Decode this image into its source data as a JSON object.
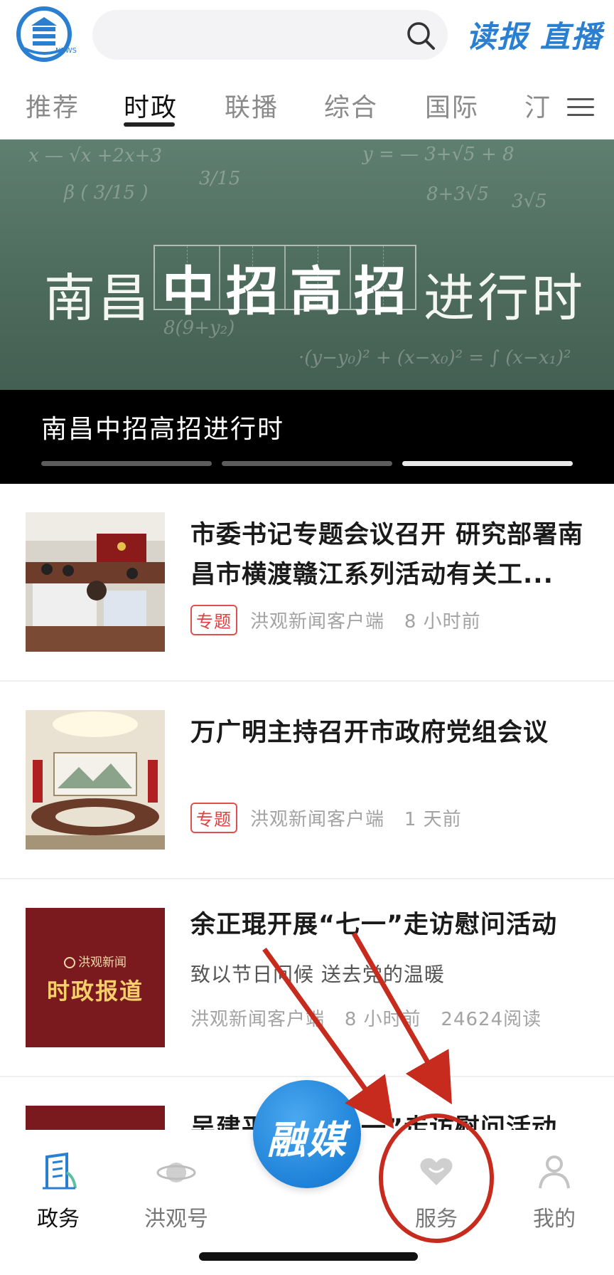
{
  "header": {
    "logo_text": "NEWS",
    "search_placeholder": "",
    "dubao_label": "读报",
    "zhibo_label": "直播"
  },
  "tabs": [
    {
      "label": "推荐"
    },
    {
      "label": "时政"
    },
    {
      "label": "联播"
    },
    {
      "label": "综合"
    },
    {
      "label": "国际"
    },
    {
      "label": "汀"
    }
  ],
  "active_tab": "时政",
  "banner": {
    "headline_left": "南昌",
    "headline_big": "中招高招",
    "headline_right": "进行时",
    "caption": "南昌中招高招进行时",
    "slide_count": 3,
    "active_slide": 3
  },
  "news": [
    {
      "title": "市委书记专题会议召开 研究部署南昌市横渡赣江系列活动有关工...",
      "tag": "专题",
      "source": "洪观新闻客户端",
      "time": "8 小时前"
    },
    {
      "title": "万广明主持召开市政府党组会议",
      "tag": "专题",
      "source": "洪观新闻客户端",
      "time": "1 天前"
    },
    {
      "title": "余正琨开展“七一”走访慰问活动",
      "subtitle": "致以节日问候 送去党的温暖",
      "thumb_brand": "洪观新闻",
      "thumb_title": "时政报道",
      "source": "洪观新闻客户端",
      "time": "8 小时前",
      "reads": "24624阅读"
    },
    {
      "title": "吴建平开展“七一”走访慰问活动"
    }
  ],
  "bottom_nav": {
    "items": [
      {
        "label": "政务",
        "icon": "government-icon",
        "active": true
      },
      {
        "label": "洪观号",
        "icon": "planet-icon",
        "active": false
      },
      {
        "label": "服务",
        "icon": "heart-icon",
        "active": false
      },
      {
        "label": "我的",
        "icon": "profile-icon",
        "active": false
      }
    ],
    "center_label": "融媒"
  },
  "colors": {
    "brand_blue": "#2a7fd1",
    "tag_red": "#e04040",
    "annotation_red": "#c62b1e",
    "banner_green": "#5f7f70",
    "thumb_maroon": "#7a1a1f"
  }
}
